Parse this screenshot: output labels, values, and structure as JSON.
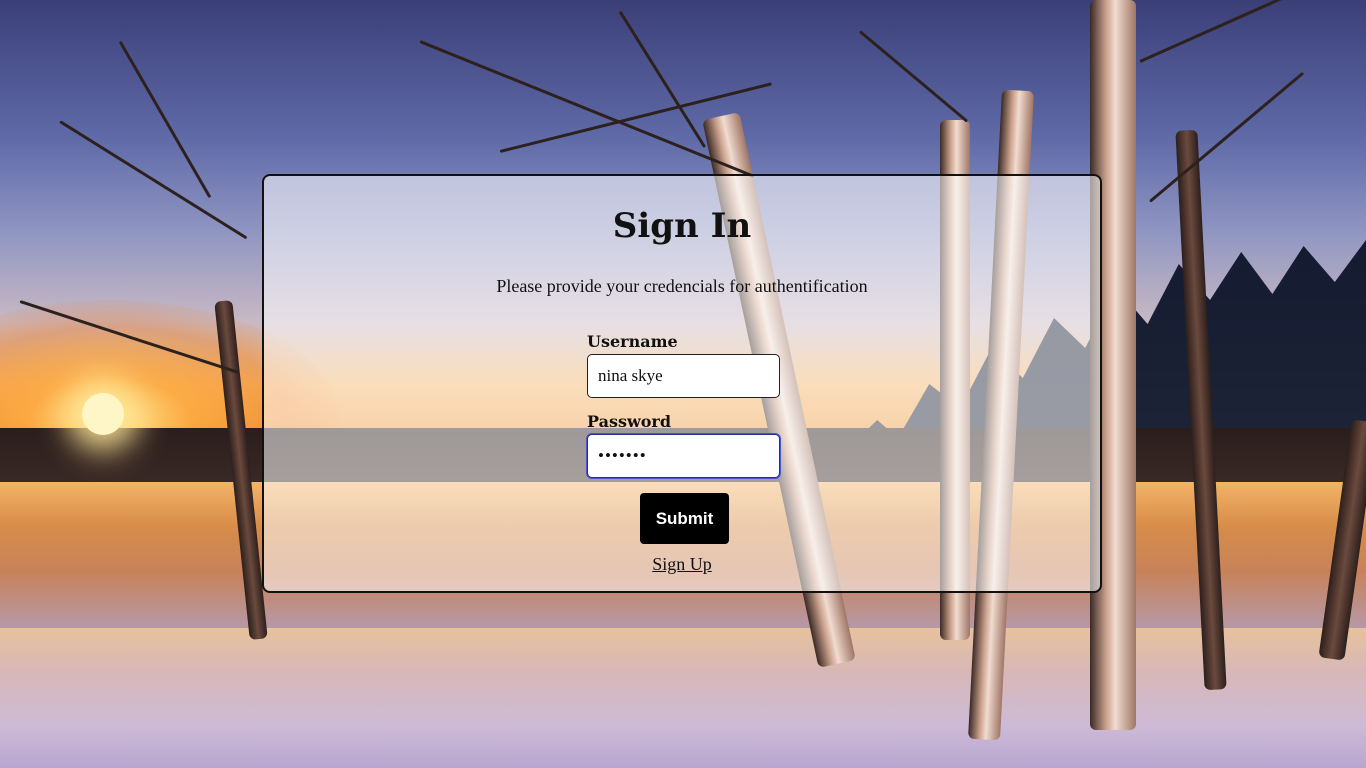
{
  "background": {
    "image": "winter-sunset-lake-birch-trees"
  },
  "signin": {
    "title": "Sign In",
    "subtitle": "Please provide your credencials for authentification",
    "username_label": "Username",
    "username_value": "nina skye",
    "password_label": "Password",
    "password_value": "•••••••",
    "submit_label": "Submit",
    "signup_label": "Sign Up"
  },
  "colors": {
    "button_bg": "#000000",
    "button_text": "#ffffff",
    "focus_border": "#2a2a9e"
  }
}
